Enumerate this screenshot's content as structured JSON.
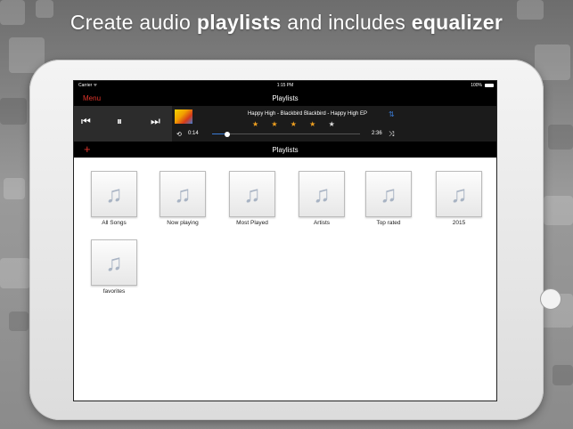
{
  "headline": {
    "part1": "Create audio ",
    "bold1": "playlists",
    "part2": " and includes ",
    "bold2": "equalizer"
  },
  "status": {
    "carrier": "Carrier ᯤ",
    "time": "1:15 PM",
    "battery": "100%"
  },
  "nav": {
    "menu": "Menu",
    "title": "Playlists"
  },
  "player": {
    "track": "Happy High - Blackbird Blackbird - Happy High EP",
    "stars_on": "★ ★ ★ ★ ",
    "stars_off": "★",
    "elapsed": "0:14",
    "total": "2:36",
    "progress": 0.1,
    "icons": {
      "prev": "⏮",
      "pause": "⏸",
      "next": "⏭",
      "eq": "equalizer-icon",
      "repeat": "repeat-icon",
      "shuffle": "shuffle-icon"
    }
  },
  "subbar": {
    "add": "+",
    "title": "Playlists"
  },
  "playlists": [
    {
      "label": "All Songs"
    },
    {
      "label": "Now playing"
    },
    {
      "label": "Most Played"
    },
    {
      "label": "Artists"
    },
    {
      "label": "Top rated"
    },
    {
      "label": "2015"
    },
    {
      "label": "favorites"
    }
  ],
  "colors": {
    "accent": "#e0352b",
    "stars": "#f0a020",
    "progress": "#3a7bd5"
  }
}
